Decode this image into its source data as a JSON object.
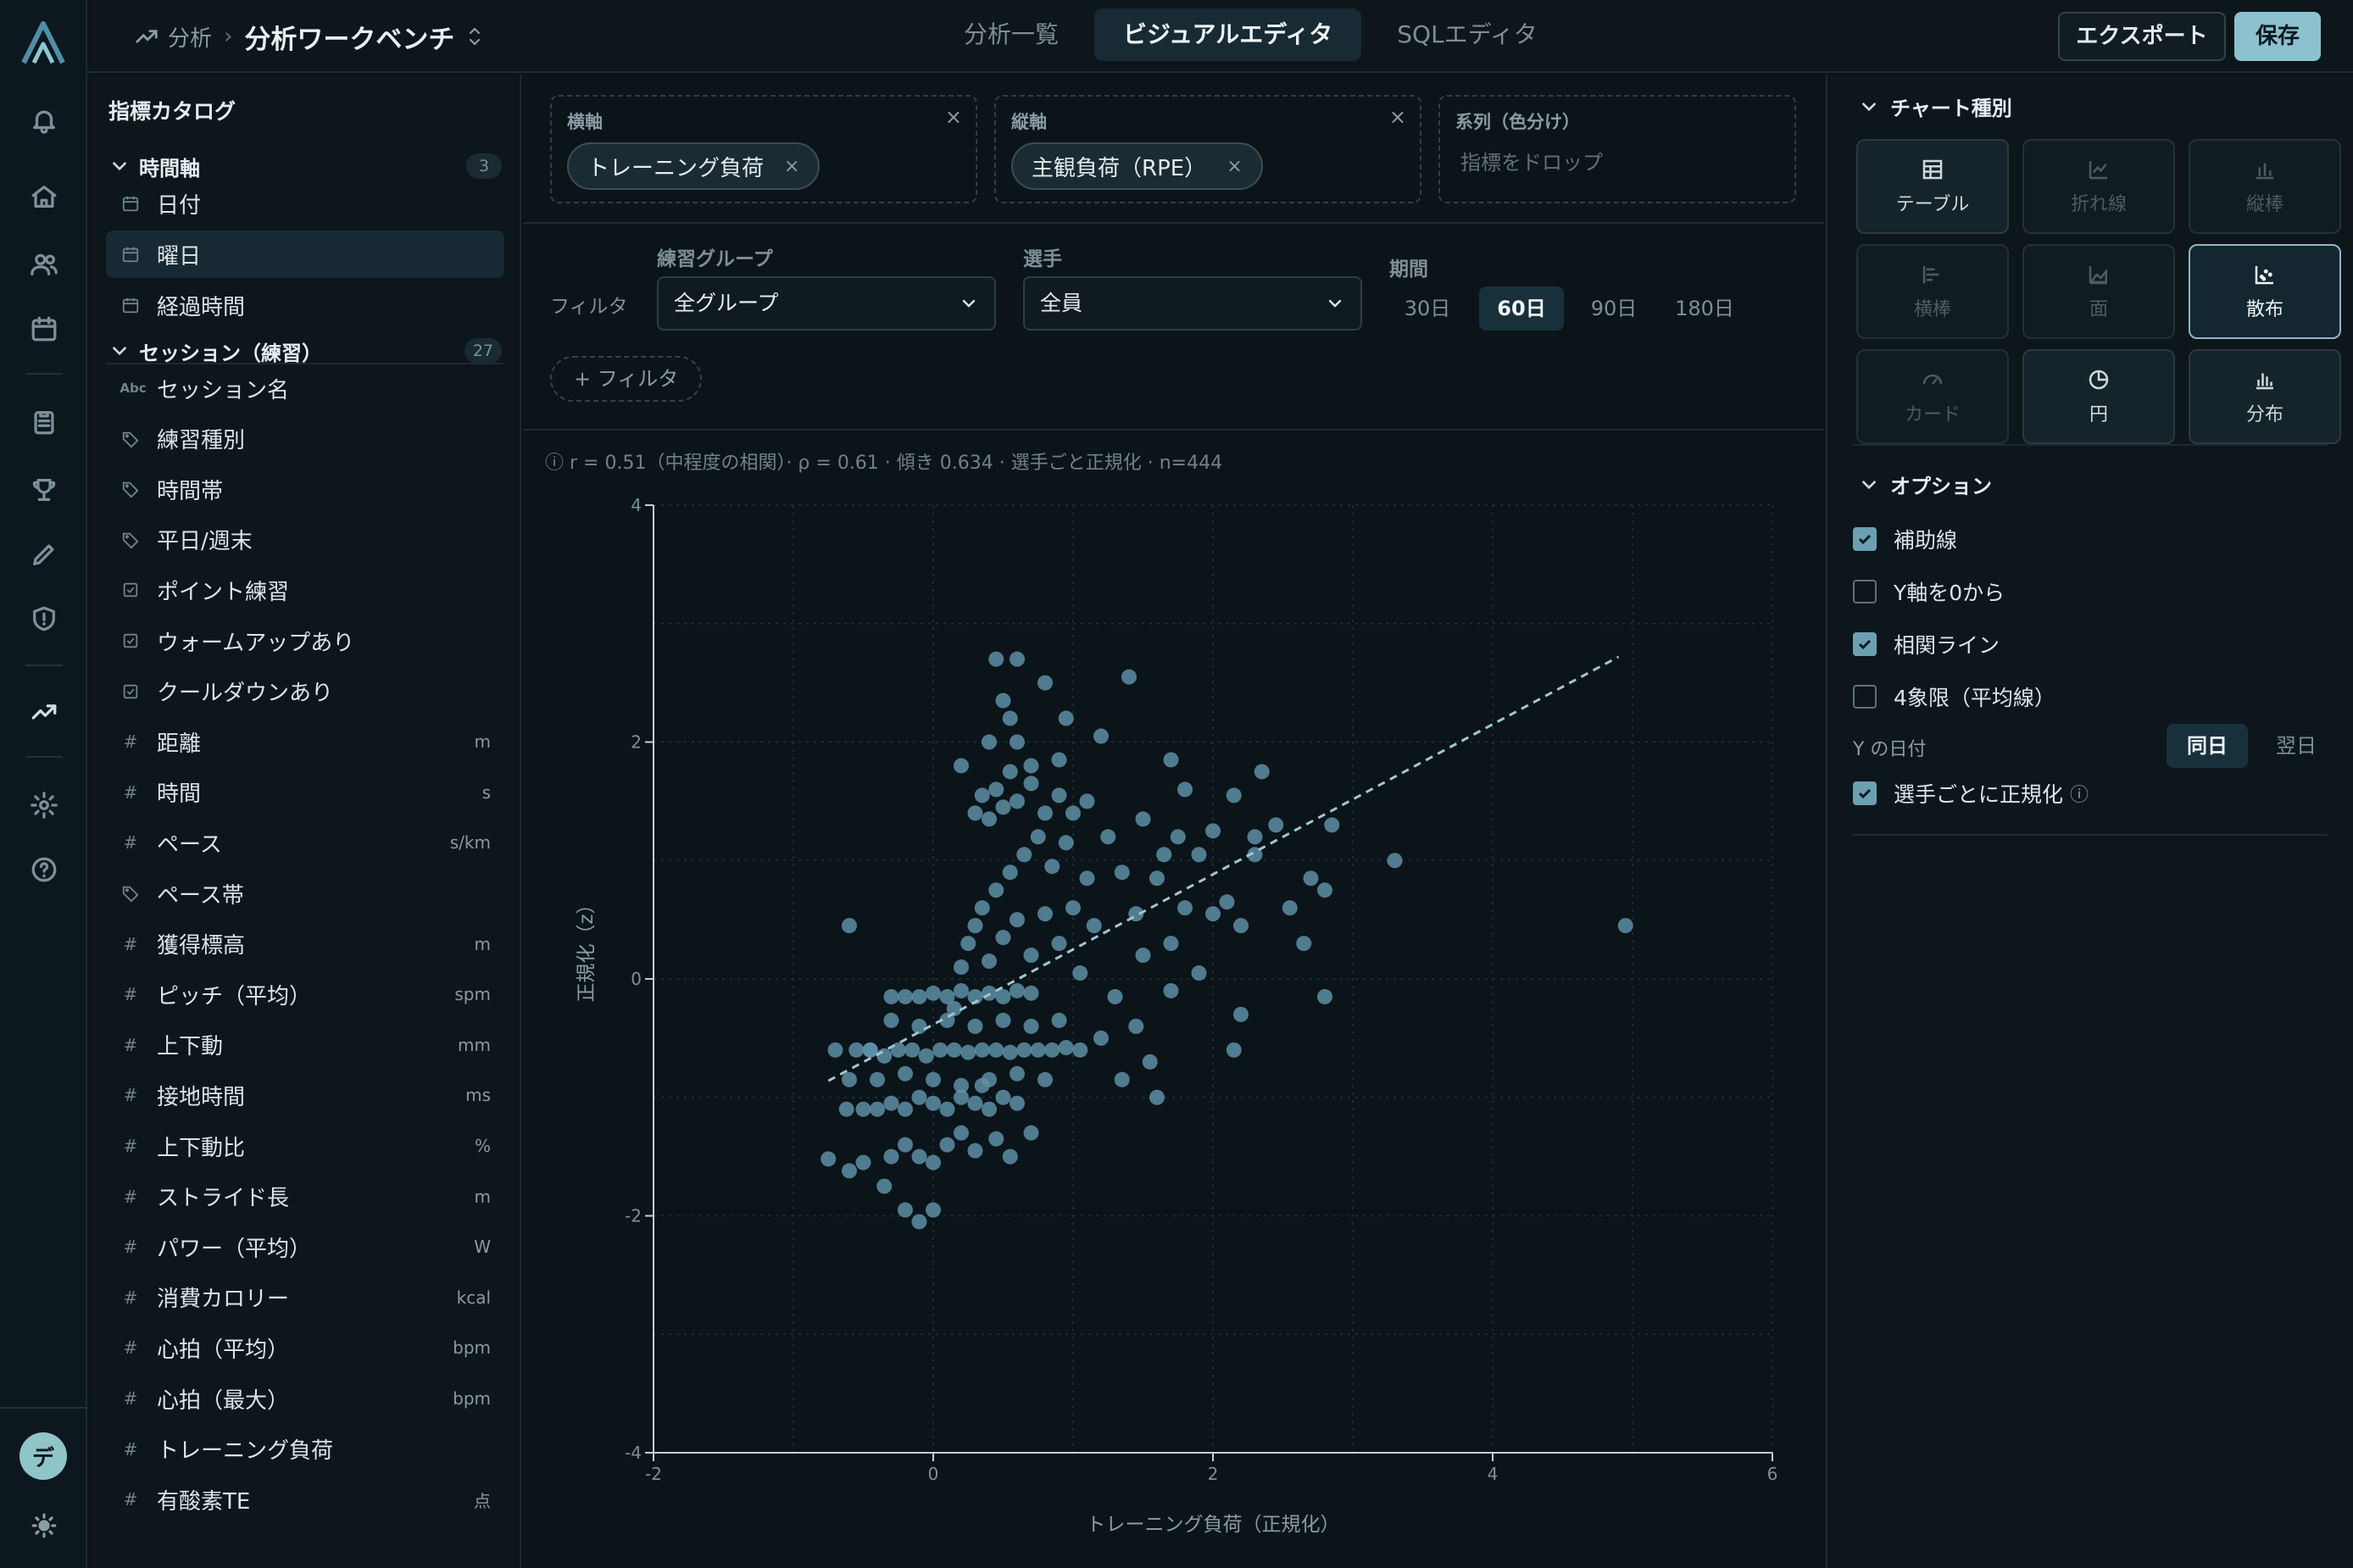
{
  "rail": {
    "avatar_initial": "デ",
    "items": [
      "bell-icon",
      "home-icon",
      "users-icon",
      "calendar-icon",
      "clipboard-icon",
      "trophy-icon",
      "pencil-icon",
      "shield-icon",
      "trend-icon",
      "gear-icon",
      "help-icon"
    ]
  },
  "header": {
    "breadcrumb_parent": "分析",
    "title": "分析ワークベンチ",
    "tabs": [
      "分析一覧",
      "ビジュアルエディタ",
      "SQLエディタ"
    ],
    "active_tab": "ビジュアルエディタ",
    "export_label": "エクスポート",
    "save_label": "保存"
  },
  "catalog": {
    "title": "指標カタログ",
    "groups": [
      {
        "label": "時間軸",
        "count": "3",
        "items": [
          {
            "label": "日付",
            "kind": "calendar",
            "unit": ""
          },
          {
            "label": "曜日",
            "kind": "calendar",
            "unit": "",
            "selected": true
          },
          {
            "label": "経過時間",
            "kind": "calendar",
            "unit": ""
          }
        ]
      },
      {
        "label": "セッション（練習）",
        "count": "27",
        "items": [
          {
            "label": "セッション名",
            "kind": "abc",
            "unit": ""
          },
          {
            "label": "練習種別",
            "kind": "tag",
            "unit": ""
          },
          {
            "label": "時間帯",
            "kind": "tag",
            "unit": ""
          },
          {
            "label": "平日/週末",
            "kind": "tag",
            "unit": ""
          },
          {
            "label": "ポイント練習",
            "kind": "check",
            "unit": ""
          },
          {
            "label": "ウォームアップあり",
            "kind": "check",
            "unit": ""
          },
          {
            "label": "クールダウンあり",
            "kind": "check",
            "unit": ""
          },
          {
            "label": "距離",
            "kind": "num",
            "unit": "m"
          },
          {
            "label": "時間",
            "kind": "num",
            "unit": "s"
          },
          {
            "label": "ペース",
            "kind": "num",
            "unit": "s/km"
          },
          {
            "label": "ペース帯",
            "kind": "tag",
            "unit": ""
          },
          {
            "label": "獲得標高",
            "kind": "num",
            "unit": "m"
          },
          {
            "label": "ピッチ（平均）",
            "kind": "num",
            "unit": "spm"
          },
          {
            "label": "上下動",
            "kind": "num",
            "unit": "mm"
          },
          {
            "label": "接地時間",
            "kind": "num",
            "unit": "ms"
          },
          {
            "label": "上下動比",
            "kind": "num",
            "unit": "%"
          },
          {
            "label": "ストライド長",
            "kind": "num",
            "unit": "m"
          },
          {
            "label": "パワー（平均）",
            "kind": "num",
            "unit": "W"
          },
          {
            "label": "消費カロリー",
            "kind": "num",
            "unit": "kcal"
          },
          {
            "label": "心拍（平均）",
            "kind": "num",
            "unit": "bpm"
          },
          {
            "label": "心拍（最大）",
            "kind": "num",
            "unit": "bpm"
          },
          {
            "label": "トレーニング負荷",
            "kind": "num",
            "unit": ""
          },
          {
            "label": "有酸素TE",
            "kind": "num",
            "unit": "点"
          }
        ]
      }
    ]
  },
  "wells": {
    "x": {
      "label": "横軸",
      "chip": "トレーニング負荷"
    },
    "y": {
      "label": "縦軸",
      "chip": "主観負荷（RPE）"
    },
    "series": {
      "label": "系列（色分け）",
      "placeholder": "指標をドロップ"
    }
  },
  "filters": {
    "label": "フィルタ",
    "group_label": "練習グループ",
    "group_value": "全グループ",
    "player_label": "選手",
    "player_value": "全員",
    "period_label": "期間",
    "periods": [
      "30日",
      "60日",
      "90日",
      "180日"
    ],
    "active_period": "60日",
    "add_label": "+ フィルタ"
  },
  "stats_line": "r = 0.51（中程度の相関）· ρ = 0.61 · 傾き 0.634 · 選手ごと正規化 · n=444",
  "chart_data": {
    "type": "scatter",
    "title": "",
    "xlabel": "トレーニング負荷（正規化）",
    "ylabel": "正規化（z）",
    "xlim": [
      -2,
      6
    ],
    "ylim": [
      -4,
      4
    ],
    "xticks": [
      -2,
      0,
      2,
      4,
      6
    ],
    "yticks": [
      -4,
      -2,
      0,
      2,
      4
    ],
    "grid": true,
    "point_color": "#5f94aa",
    "trend_color": "#9ec8d0",
    "trendline": {
      "x": [
        -0.75,
        4.9
      ],
      "y": [
        -0.86,
        2.72
      ]
    },
    "points": [
      [
        -0.7,
        -0.6
      ],
      [
        -0.55,
        -0.6
      ],
      [
        -0.62,
        -1.1
      ],
      [
        -0.5,
        -1.1
      ],
      [
        -0.4,
        -1.1
      ],
      [
        -0.3,
        -1.05
      ],
      [
        -0.2,
        -1.1
      ],
      [
        -0.1,
        -1.0
      ],
      [
        0.0,
        -1.05
      ],
      [
        0.1,
        -1.1
      ],
      [
        0.2,
        -1.0
      ],
      [
        0.3,
        -1.05
      ],
      [
        0.4,
        -1.1
      ],
      [
        0.5,
        -1.0
      ],
      [
        0.6,
        -1.05
      ],
      [
        -0.45,
        -0.6
      ],
      [
        -0.35,
        -0.65
      ],
      [
        -0.25,
        -0.6
      ],
      [
        -0.15,
        -0.6
      ],
      [
        -0.05,
        -0.65
      ],
      [
        0.05,
        -0.6
      ],
      [
        0.15,
        -0.6
      ],
      [
        0.25,
        -0.62
      ],
      [
        0.35,
        -0.6
      ],
      [
        0.45,
        -0.6
      ],
      [
        0.55,
        -0.62
      ],
      [
        0.65,
        -0.6
      ],
      [
        0.75,
        -0.6
      ],
      [
        0.85,
        -0.6
      ],
      [
        0.95,
        -0.58
      ],
      [
        1.05,
        -0.6
      ],
      [
        -0.2,
        -0.15
      ],
      [
        -0.1,
        -0.15
      ],
      [
        0.0,
        -0.12
      ],
      [
        0.1,
        -0.15
      ],
      [
        0.2,
        -0.1
      ],
      [
        0.3,
        -0.15
      ],
      [
        0.4,
        -0.12
      ],
      [
        0.5,
        -0.15
      ],
      [
        0.6,
        -0.1
      ],
      [
        0.7,
        -0.12
      ],
      [
        -0.3,
        -1.5
      ],
      [
        -0.2,
        -1.4
      ],
      [
        -0.1,
        -1.5
      ],
      [
        0.0,
        -1.55
      ],
      [
        0.1,
        -1.4
      ],
      [
        0.2,
        -1.3
      ],
      [
        0.3,
        -1.45
      ],
      [
        0.45,
        -1.35
      ],
      [
        0.55,
        -1.5
      ],
      [
        0.7,
        -1.3
      ],
      [
        -0.75,
        -1.52
      ],
      [
        -0.6,
        -1.62
      ],
      [
        -0.35,
        -1.75
      ],
      [
        -0.2,
        -1.95
      ],
      [
        -0.1,
        -2.05
      ],
      [
        0.0,
        -1.95
      ],
      [
        -0.5,
        -1.55
      ],
      [
        -0.6,
        -0.85
      ],
      [
        -0.4,
        -0.85
      ],
      [
        -0.2,
        -0.8
      ],
      [
        0.0,
        -0.85
      ],
      [
        0.2,
        -0.9
      ],
      [
        0.4,
        -0.85
      ],
      [
        0.6,
        -0.8
      ],
      [
        0.8,
        -0.85
      ],
      [
        -0.3,
        -0.35
      ],
      [
        -0.1,
        -0.4
      ],
      [
        0.1,
        -0.35
      ],
      [
        0.3,
        -0.4
      ],
      [
        0.5,
        -0.35
      ],
      [
        0.7,
        -0.4
      ],
      [
        0.9,
        -0.35
      ],
      [
        0.2,
        0.1
      ],
      [
        0.25,
        0.3
      ],
      [
        0.3,
        0.45
      ],
      [
        0.35,
        0.6
      ],
      [
        0.4,
        0.15
      ],
      [
        0.45,
        0.75
      ],
      [
        0.5,
        0.35
      ],
      [
        0.55,
        0.9
      ],
      [
        0.6,
        0.5
      ],
      [
        0.65,
        1.05
      ],
      [
        0.7,
        0.2
      ],
      [
        0.75,
        1.2
      ],
      [
        0.8,
        0.55
      ],
      [
        0.85,
        0.95
      ],
      [
        0.9,
        0.3
      ],
      [
        0.95,
        1.15
      ],
      [
        1.0,
        0.6
      ],
      [
        1.05,
        0.05
      ],
      [
        1.1,
        0.85
      ],
      [
        1.15,
        0.45
      ],
      [
        0.3,
        1.4
      ],
      [
        0.35,
        1.55
      ],
      [
        0.4,
        1.35
      ],
      [
        0.45,
        1.6
      ],
      [
        0.5,
        1.45
      ],
      [
        0.55,
        1.75
      ],
      [
        0.6,
        1.5
      ],
      [
        0.7,
        1.65
      ],
      [
        0.8,
        1.4
      ],
      [
        0.9,
        1.55
      ],
      [
        1.0,
        1.4
      ],
      [
        1.1,
        1.5
      ],
      [
        0.45,
        2.7
      ],
      [
        0.6,
        2.7
      ],
      [
        0.5,
        2.35
      ],
      [
        0.8,
        2.5
      ],
      [
        0.55,
        2.2
      ],
      [
        0.95,
        2.2
      ],
      [
        0.4,
        2.0
      ],
      [
        0.6,
        2.0
      ],
      [
        0.7,
        1.8
      ],
      [
        0.9,
        1.85
      ],
      [
        0.2,
        1.8
      ],
      [
        1.2,
        2.05
      ],
      [
        1.4,
        2.55
      ],
      [
        1.25,
        1.2
      ],
      [
        1.35,
        0.9
      ],
      [
        1.45,
        0.55
      ],
      [
        1.5,
        1.35
      ],
      [
        1.6,
        0.85
      ],
      [
        1.65,
        1.05
      ],
      [
        1.7,
        0.3
      ],
      [
        1.75,
        1.2
      ],
      [
        1.8,
        0.6
      ],
      [
        1.9,
        1.05
      ],
      [
        2.0,
        0.55
      ],
      [
        2.1,
        0.65
      ],
      [
        2.2,
        0.45
      ],
      [
        2.3,
        1.2
      ],
      [
        1.7,
        1.85
      ],
      [
        1.8,
        1.6
      ],
      [
        2.0,
        1.25
      ],
      [
        2.15,
        1.55
      ],
      [
        2.3,
        1.05
      ],
      [
        2.35,
        1.75
      ],
      [
        2.45,
        1.3
      ],
      [
        2.55,
        0.6
      ],
      [
        2.65,
        0.3
      ],
      [
        2.7,
        0.85
      ],
      [
        2.8,
        0.75
      ],
      [
        2.8,
        -0.15
      ],
      [
        2.85,
        1.3
      ],
      [
        3.3,
        1.0
      ],
      [
        4.95,
        0.45
      ],
      [
        1.2,
        -0.5
      ],
      [
        1.35,
        -0.85
      ],
      [
        1.45,
        -0.4
      ],
      [
        1.55,
        -0.7
      ],
      [
        1.6,
        -1.0
      ],
      [
        1.3,
        -0.15
      ],
      [
        1.5,
        0.2
      ],
      [
        2.2,
        -0.3
      ],
      [
        2.15,
        -0.6
      ],
      [
        1.7,
        -0.1
      ],
      [
        1.9,
        0.05
      ],
      [
        -0.45,
        -0.6
      ],
      [
        -0.3,
        -0.15
      ],
      [
        0.15,
        -0.25
      ],
      [
        0.35,
        -0.9
      ],
      [
        -0.6,
        0.45
      ]
    ]
  },
  "right_panel": {
    "chart_type_label": "チャート種別",
    "chart_types": [
      {
        "label": "テーブル",
        "icon": "table-icon",
        "state": "enabled"
      },
      {
        "label": "折れ線",
        "icon": "line-chart-icon",
        "state": "disabled"
      },
      {
        "label": "縦棒",
        "icon": "column-chart-icon",
        "state": "disabled"
      },
      {
        "label": "横棒",
        "icon": "bar-chart-icon",
        "state": "disabled"
      },
      {
        "label": "面",
        "icon": "area-chart-icon",
        "state": "disabled"
      },
      {
        "label": "散布",
        "icon": "scatter-icon",
        "state": "active"
      },
      {
        "label": "カード",
        "icon": "gauge-icon",
        "state": "disabled"
      },
      {
        "label": "円",
        "icon": "pie-icon",
        "state": "enabled"
      },
      {
        "label": "分布",
        "icon": "histogram-icon",
        "state": "enabled"
      }
    ],
    "options_label": "オプション",
    "options": [
      {
        "label": "補助線",
        "checked": true
      },
      {
        "label": "Y軸を0から",
        "checked": false
      },
      {
        "label": "相関ライン",
        "checked": true
      },
      {
        "label": "4象限（平均線）",
        "checked": false
      }
    ],
    "ydate_label": "Y の日付",
    "ydate_options": [
      "同日",
      "翌日"
    ],
    "ydate_active": "同日",
    "normalize_label": "選手ごとに正規化",
    "normalize_checked": true
  }
}
